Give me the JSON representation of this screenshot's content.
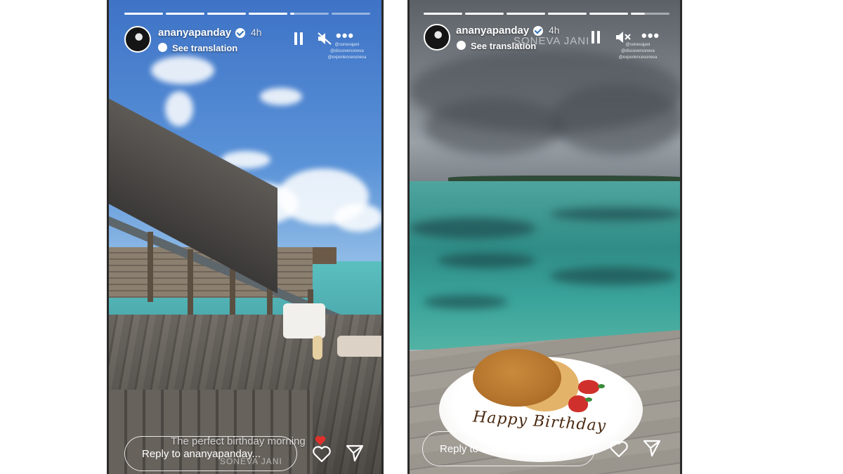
{
  "stories": [
    {
      "username": "ananyapanday",
      "time": "4h",
      "see_translation": "See translation",
      "tags": [
        "@sonevajani",
        "@discoversoneva",
        "@experiencesoneva"
      ],
      "caption": "The perfect birthday morning",
      "watermark": "SONEVA JANI",
      "reply_placeholder": "Reply to ananyapanday...",
      "progress": {
        "total": 6,
        "completed": 4,
        "current_fraction": 0.1
      }
    },
    {
      "username": "ananyapanday",
      "time": "4h",
      "see_translation": "See translation",
      "tags": [
        "@sonevajani",
        "@discoversoneva",
        "@experiencesoneva"
      ],
      "watermark": "SONEVA JANI",
      "plate_writing": "Happy Birthday",
      "reply_placeholder": "Reply to ananyapanday...",
      "progress": {
        "total": 6,
        "completed": 5,
        "current_fraction": 0.35
      }
    }
  ],
  "icons": {
    "pause": "pause-icon",
    "mute": "speaker-muted-icon",
    "more": "more-horizontal-icon",
    "like": "heart-outline-icon",
    "share": "paper-plane-icon",
    "translation": "globe-bubble-icon",
    "verified": "verified-badge-icon"
  },
  "colors": {
    "text": "#ffffff",
    "verified": "#ffffff",
    "caption_heart": "#e0302b"
  }
}
